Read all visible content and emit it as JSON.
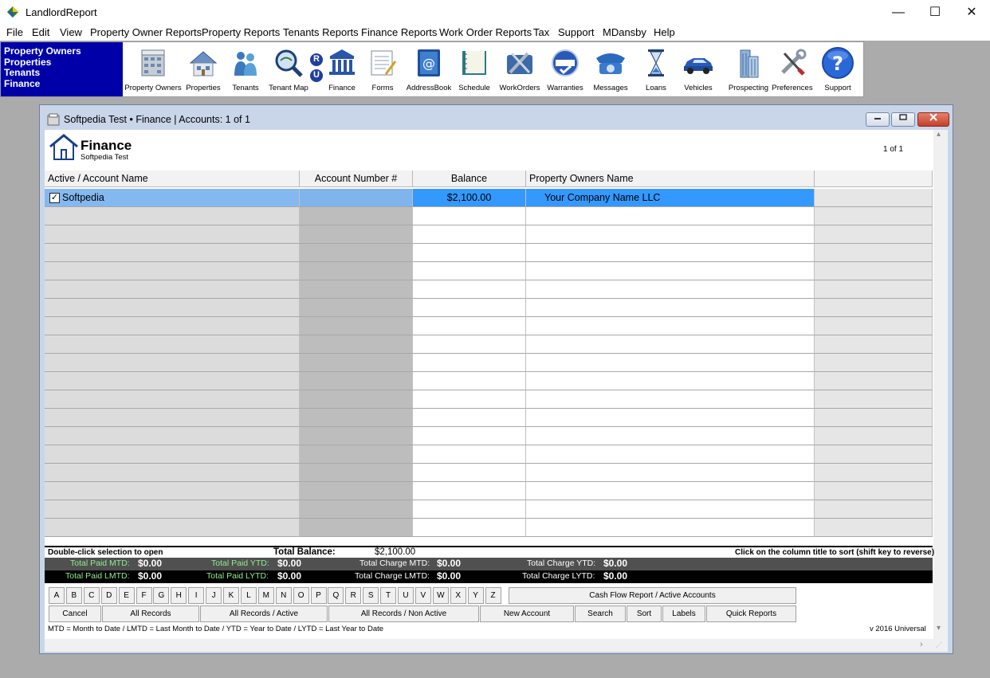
{
  "window": {
    "title": "LandlordReport",
    "minimize": "—",
    "maximize": "☐",
    "close": "✕"
  },
  "menu": [
    "File",
    "Edit",
    "View",
    "Property Owner Reports",
    "Property Reports",
    "Tenants Reports",
    "Finance Reports",
    "Work Order Reports",
    "Tax",
    "Support",
    "MDansby",
    "Help"
  ],
  "nav_panel": [
    "Property Owners",
    "Properties",
    "Tenants",
    "Finance"
  ],
  "toolbar": [
    {
      "label": "Property Owners",
      "icon": "building-icon"
    },
    {
      "label": "Properties",
      "icon": "house-icon"
    },
    {
      "label": "Tenants",
      "icon": "people-icon"
    },
    {
      "label": "Tenant Map",
      "icon": "map-search-icon"
    },
    {
      "label": "",
      "icon": "ru-badge-icon"
    },
    {
      "label": "Finance",
      "icon": "bank-icon"
    },
    {
      "label": "Forms",
      "icon": "forms-icon"
    },
    {
      "label": "AddressBook",
      "icon": "address-book-icon"
    },
    {
      "label": "Schedule",
      "icon": "schedule-book-icon"
    },
    {
      "label": "WorkOrders",
      "icon": "tools-icon"
    },
    {
      "label": "Warranties",
      "icon": "warranty-badge-icon"
    },
    {
      "label": "Messages",
      "icon": "telephone-icon"
    },
    {
      "label": "Loans",
      "icon": "hourglass-icon"
    },
    {
      "label": "Vehicles",
      "icon": "car-icon"
    },
    {
      "label": "Prospecting",
      "icon": "skyscraper-icon"
    },
    {
      "label": "Preferences",
      "icon": "wrench-screwdriver-icon"
    },
    {
      "label": "Support",
      "icon": "help-icon"
    }
  ],
  "ru_letters": [
    "R",
    "U"
  ],
  "child": {
    "title": "Softpedia Test  •  Finance | Accounts: 1 of 1",
    "heading": "Finance",
    "subheading": "Softpedia Test",
    "pager": "1   of   1"
  },
  "grid": {
    "headers": [
      "Active / Account Name",
      "Account Number #",
      "Balance",
      "Property Owners Name"
    ],
    "rows": [
      {
        "active": true,
        "name": "Softpedia",
        "account_number": "",
        "balance": "$2,100.00",
        "owner": "Your Company Name LLC"
      }
    ]
  },
  "status": {
    "hint_left": "Double-click selection to open",
    "total_balance_label": "Total Balance:",
    "total_balance": "$2,100.00",
    "hint_right": "Click on the column title to sort (shift key to reverse)",
    "paid_mtd_label": "Total Paid MTD:",
    "paid_mtd": "$0.00",
    "paid_ytd_label": "Total Paid YTD:",
    "paid_ytd": "$0.00",
    "charge_mtd_label": "Total Charge MTD:",
    "charge_mtd": "$0.00",
    "charge_ytd_label": "Total Charge YTD:",
    "charge_ytd": "$0.00",
    "paid_lmtd_label": "Total Paid LMTD:",
    "paid_lmtd": "$0.00",
    "paid_lytd_label": "Total Paid LYTD:",
    "paid_lytd": "$0.00",
    "charge_lmtd_label": "Total Charge LMTD:",
    "charge_lmtd": "$0.00",
    "charge_lytd_label": "Total Charge LYTD:",
    "charge_lytd": "$0.00"
  },
  "alphabet": [
    "A",
    "B",
    "C",
    "D",
    "E",
    "F",
    "G",
    "H",
    "I",
    "J",
    "K",
    "L",
    "M",
    "N",
    "O",
    "P",
    "Q",
    "R",
    "S",
    "T",
    "U",
    "V",
    "W",
    "X",
    "Y",
    "Z"
  ],
  "buttons": {
    "cash_flow": "Cash Flow Report / Active Accounts",
    "cancel": "Cancel",
    "all_records": "All Records",
    "all_active": "All Records / Active",
    "all_non_active": "All Records / Non Active",
    "new_account": "New Account",
    "search": "Search",
    "sort": "Sort",
    "labels": "Labels",
    "quick_reports": "Quick Reports"
  },
  "legend": "MTD = Month to Date  /  LMTD = Last Month to Date  /  YTD = Year to Date  /  LYTD = Last Year to Date",
  "version": "v 2016 Universal",
  "colors": {
    "nav_panel": "#0000a8",
    "selected_row": "#3399ff",
    "green_label": "#90ee90",
    "status_dark": "#505050"
  }
}
